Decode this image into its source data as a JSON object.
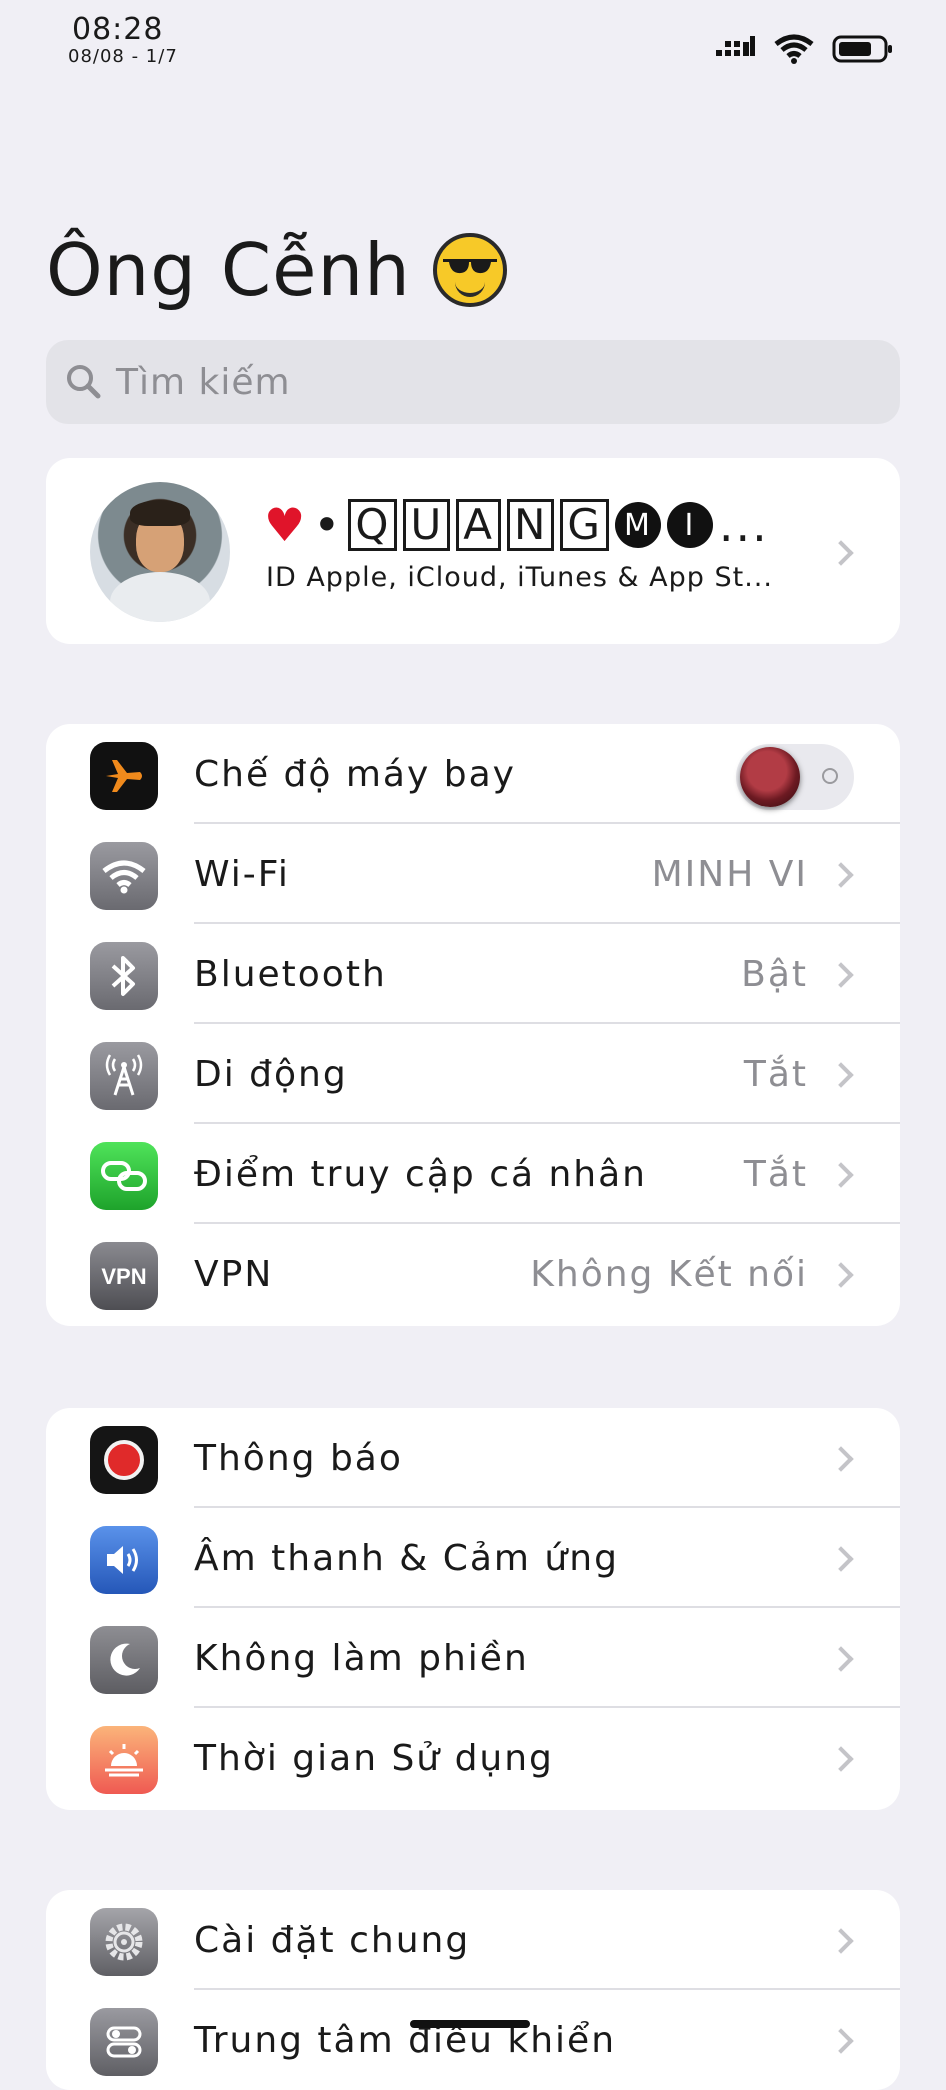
{
  "status_bar": {
    "time": "08:28",
    "date": "08/08 - 1/7"
  },
  "header": {
    "title": "Ông Cễnh"
  },
  "search": {
    "placeholder": "Tìm kiếm"
  },
  "profile": {
    "name_prefix": "•",
    "name_boxed": [
      "Q",
      "U",
      "A",
      "N",
      "G"
    ],
    "name_circled": [
      "M",
      "I"
    ],
    "name_suffix": "...",
    "subtitle": "ID Apple, iCloud, iTunes & App St..."
  },
  "group1": [
    {
      "label": "Chế độ máy bay",
      "value": "",
      "icon": "airplane-icon",
      "color": "#111111",
      "control": "toggle",
      "toggle_on": false
    },
    {
      "label": "Wi-Fi",
      "value": "MINH VI",
      "icon": "wifi-icon",
      "color": "#7d7d82"
    },
    {
      "label": "Bluetooth",
      "value": "Bật",
      "icon": "bluetooth-icon",
      "color": "#7d7d82"
    },
    {
      "label": "Di động",
      "value": "Tắt",
      "icon": "cellular-icon",
      "color": "#7d7d82"
    },
    {
      "label": "Điểm truy cập cá nhân",
      "value": "Tắt",
      "icon": "hotspot-icon",
      "color": "#2ec43a"
    },
    {
      "label": "VPN",
      "value": "Không Kết nối",
      "icon": "vpn-icon",
      "color": "#5b5b60"
    }
  ],
  "group2": [
    {
      "label": "Thông báo",
      "icon": "notifications-icon",
      "color": "#151515"
    },
    {
      "label": "Âm thanh & Cảm ứng",
      "icon": "sound-icon",
      "color": "#2f6dd1"
    },
    {
      "label": "Không làm phiền",
      "icon": "moon-icon",
      "color": "#6e6e73"
    },
    {
      "label": "Thời gian Sử dụng",
      "icon": "screen-time-icon",
      "color": "#f26f52"
    }
  ],
  "group3": [
    {
      "label": "Cài đặt chung",
      "icon": "gear-icon",
      "color": "#6e6e73"
    },
    {
      "label": "Trung tâm điều khiển",
      "icon": "control-center-icon",
      "color": "#6e6e73"
    }
  ]
}
